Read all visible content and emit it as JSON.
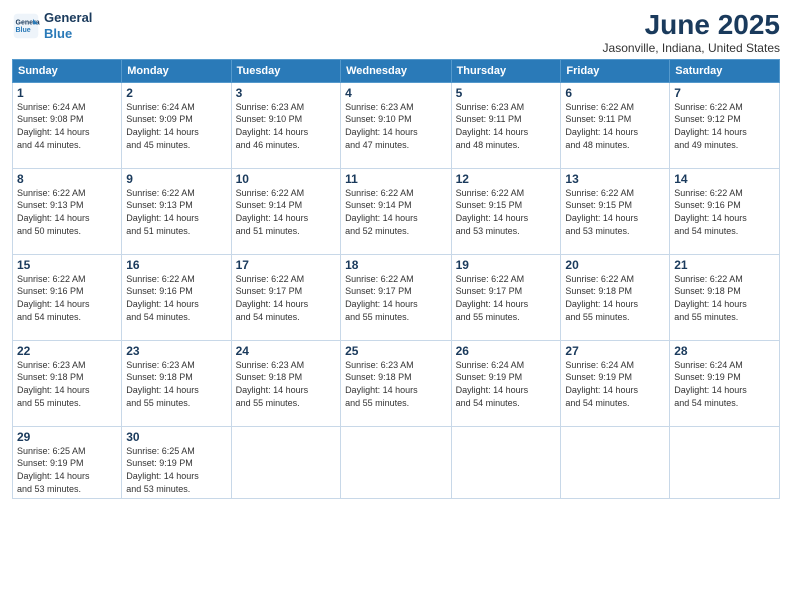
{
  "header": {
    "logo_line1": "General",
    "logo_line2": "Blue",
    "title": "June 2025",
    "location": "Jasonville, Indiana, United States"
  },
  "days_of_week": [
    "Sunday",
    "Monday",
    "Tuesday",
    "Wednesday",
    "Thursday",
    "Friday",
    "Saturday"
  ],
  "weeks": [
    [
      {
        "day": "1",
        "info": "Sunrise: 6:24 AM\nSunset: 9:08 PM\nDaylight: 14 hours\nand 44 minutes."
      },
      {
        "day": "2",
        "info": "Sunrise: 6:24 AM\nSunset: 9:09 PM\nDaylight: 14 hours\nand 45 minutes."
      },
      {
        "day": "3",
        "info": "Sunrise: 6:23 AM\nSunset: 9:10 PM\nDaylight: 14 hours\nand 46 minutes."
      },
      {
        "day": "4",
        "info": "Sunrise: 6:23 AM\nSunset: 9:10 PM\nDaylight: 14 hours\nand 47 minutes."
      },
      {
        "day": "5",
        "info": "Sunrise: 6:23 AM\nSunset: 9:11 PM\nDaylight: 14 hours\nand 48 minutes."
      },
      {
        "day": "6",
        "info": "Sunrise: 6:22 AM\nSunset: 9:11 PM\nDaylight: 14 hours\nand 48 minutes."
      },
      {
        "day": "7",
        "info": "Sunrise: 6:22 AM\nSunset: 9:12 PM\nDaylight: 14 hours\nand 49 minutes."
      }
    ],
    [
      {
        "day": "8",
        "info": "Sunrise: 6:22 AM\nSunset: 9:13 PM\nDaylight: 14 hours\nand 50 minutes."
      },
      {
        "day": "9",
        "info": "Sunrise: 6:22 AM\nSunset: 9:13 PM\nDaylight: 14 hours\nand 51 minutes."
      },
      {
        "day": "10",
        "info": "Sunrise: 6:22 AM\nSunset: 9:14 PM\nDaylight: 14 hours\nand 51 minutes."
      },
      {
        "day": "11",
        "info": "Sunrise: 6:22 AM\nSunset: 9:14 PM\nDaylight: 14 hours\nand 52 minutes."
      },
      {
        "day": "12",
        "info": "Sunrise: 6:22 AM\nSunset: 9:15 PM\nDaylight: 14 hours\nand 53 minutes."
      },
      {
        "day": "13",
        "info": "Sunrise: 6:22 AM\nSunset: 9:15 PM\nDaylight: 14 hours\nand 53 minutes."
      },
      {
        "day": "14",
        "info": "Sunrise: 6:22 AM\nSunset: 9:16 PM\nDaylight: 14 hours\nand 54 minutes."
      }
    ],
    [
      {
        "day": "15",
        "info": "Sunrise: 6:22 AM\nSunset: 9:16 PM\nDaylight: 14 hours\nand 54 minutes."
      },
      {
        "day": "16",
        "info": "Sunrise: 6:22 AM\nSunset: 9:16 PM\nDaylight: 14 hours\nand 54 minutes."
      },
      {
        "day": "17",
        "info": "Sunrise: 6:22 AM\nSunset: 9:17 PM\nDaylight: 14 hours\nand 54 minutes."
      },
      {
        "day": "18",
        "info": "Sunrise: 6:22 AM\nSunset: 9:17 PM\nDaylight: 14 hours\nand 55 minutes."
      },
      {
        "day": "19",
        "info": "Sunrise: 6:22 AM\nSunset: 9:17 PM\nDaylight: 14 hours\nand 55 minutes."
      },
      {
        "day": "20",
        "info": "Sunrise: 6:22 AM\nSunset: 9:18 PM\nDaylight: 14 hours\nand 55 minutes."
      },
      {
        "day": "21",
        "info": "Sunrise: 6:22 AM\nSunset: 9:18 PM\nDaylight: 14 hours\nand 55 minutes."
      }
    ],
    [
      {
        "day": "22",
        "info": "Sunrise: 6:23 AM\nSunset: 9:18 PM\nDaylight: 14 hours\nand 55 minutes."
      },
      {
        "day": "23",
        "info": "Sunrise: 6:23 AM\nSunset: 9:18 PM\nDaylight: 14 hours\nand 55 minutes."
      },
      {
        "day": "24",
        "info": "Sunrise: 6:23 AM\nSunset: 9:18 PM\nDaylight: 14 hours\nand 55 minutes."
      },
      {
        "day": "25",
        "info": "Sunrise: 6:23 AM\nSunset: 9:18 PM\nDaylight: 14 hours\nand 55 minutes."
      },
      {
        "day": "26",
        "info": "Sunrise: 6:24 AM\nSunset: 9:19 PM\nDaylight: 14 hours\nand 54 minutes."
      },
      {
        "day": "27",
        "info": "Sunrise: 6:24 AM\nSunset: 9:19 PM\nDaylight: 14 hours\nand 54 minutes."
      },
      {
        "day": "28",
        "info": "Sunrise: 6:24 AM\nSunset: 9:19 PM\nDaylight: 14 hours\nand 54 minutes."
      }
    ],
    [
      {
        "day": "29",
        "info": "Sunrise: 6:25 AM\nSunset: 9:19 PM\nDaylight: 14 hours\nand 53 minutes."
      },
      {
        "day": "30",
        "info": "Sunrise: 6:25 AM\nSunset: 9:19 PM\nDaylight: 14 hours\nand 53 minutes."
      },
      {
        "day": "",
        "info": ""
      },
      {
        "day": "",
        "info": ""
      },
      {
        "day": "",
        "info": ""
      },
      {
        "day": "",
        "info": ""
      },
      {
        "day": "",
        "info": ""
      }
    ]
  ]
}
